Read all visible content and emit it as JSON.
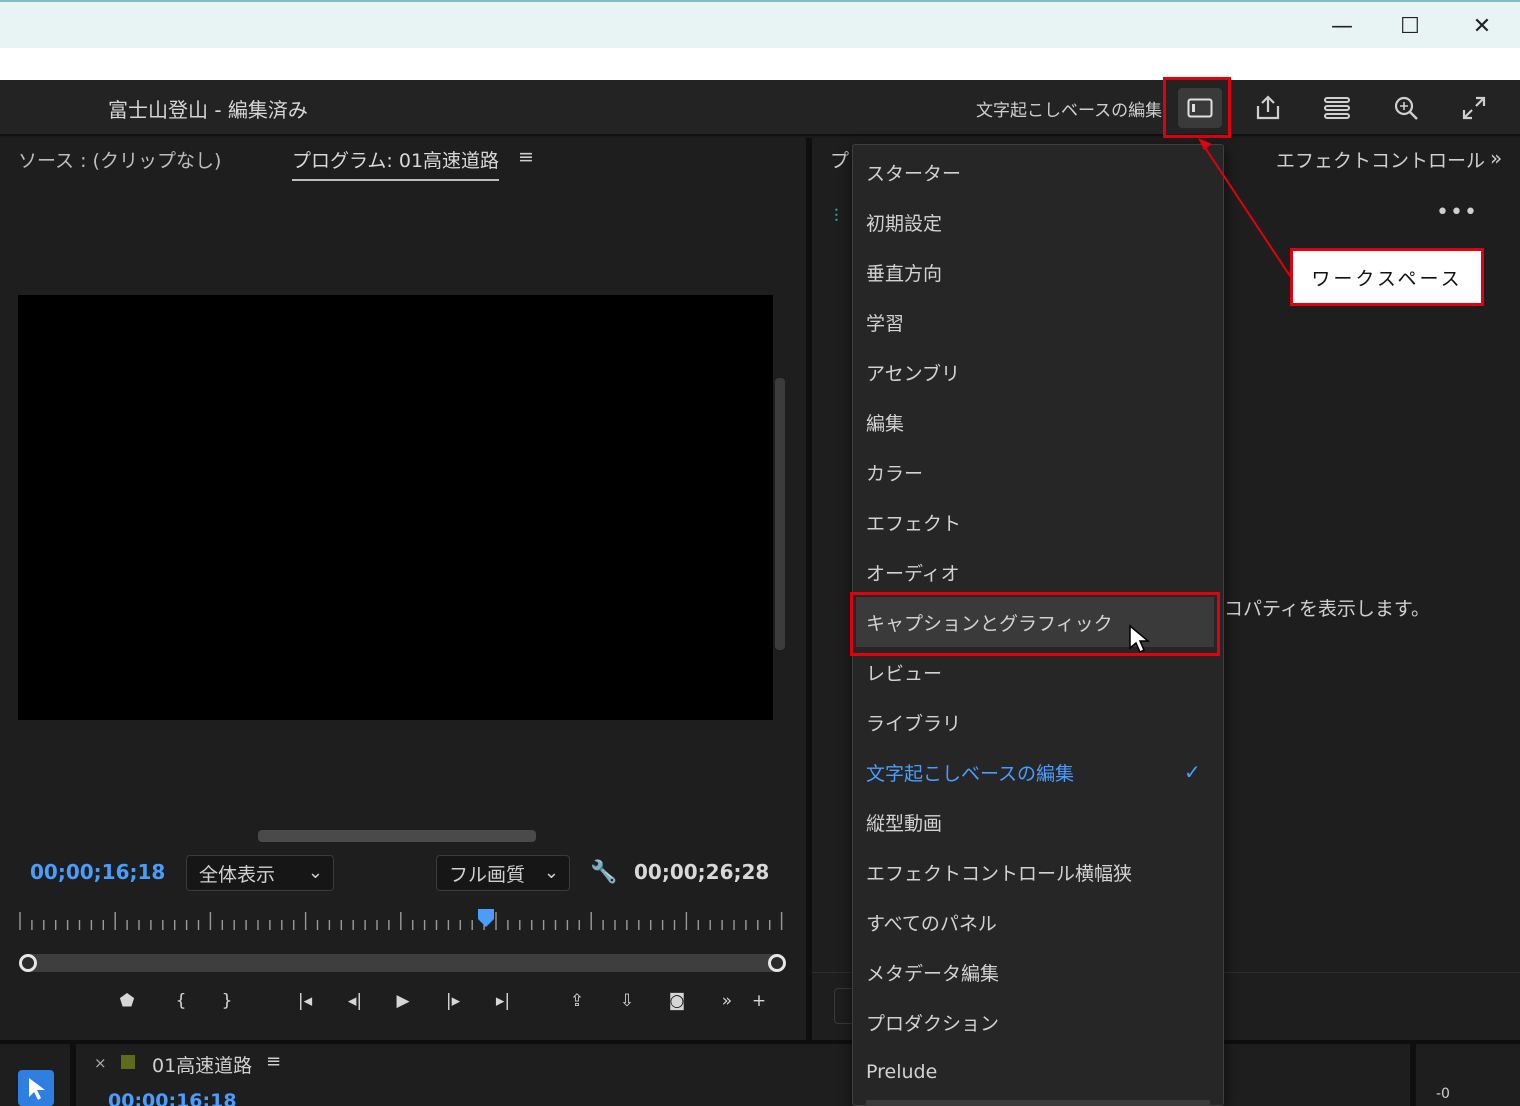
{
  "window": {
    "minimize_glyph": "—",
    "maximize_glyph": "☐",
    "close_glyph": "✕"
  },
  "header": {
    "project_title": "富士山登山 - 編集済み",
    "workspace_label": "文字起こしベースの編集",
    "icons": [
      "workspace-icon",
      "export-icon",
      "quick-export-icon",
      "search-icon",
      "fullscreen-icon"
    ]
  },
  "left_panel": {
    "tab_source": "ソース : (クリップなし)",
    "tab_program": "プログラム: 01高速道路",
    "tab_menu": "≡",
    "timecode_current": "00;00;16;18",
    "zoom_select": "全体表示",
    "quality_select": "フル画質",
    "timecode_duration": "00;00;26;28",
    "playhead_fraction": 0.61,
    "transport_glyphs": [
      "⬟",
      "{",
      "}",
      "|◂",
      "◂|",
      "▶",
      "|▸",
      "▸|",
      "⇪",
      "⇩",
      "◙",
      "»",
      "+"
    ]
  },
  "right_panel": {
    "tab_p": "プ",
    "tab_effect_controls": "エフェクトコントロール",
    "more_glyph": "»",
    "dots": "•••",
    "message_fragment": "コパティを表示します。"
  },
  "menu": {
    "items": [
      "スターター",
      "初期設定",
      "垂直方向",
      "学習",
      "アセンブリ",
      "編集",
      "カラー",
      "エフェクト",
      "オーディオ",
      "キャプションとグラフィック",
      "レビュー",
      "ライブラリ",
      "文字起こしベースの編集",
      "縦型動画",
      "エフェクトコントロール横幅狭",
      "すべてのパネル",
      "メタデータ編集",
      "プロダクション",
      "Prelude"
    ],
    "hover_index": 9,
    "active_index": 12,
    "check_glyph": "✓"
  },
  "callout": {
    "text": "ワークスペース"
  },
  "timeline": {
    "close_glyph": "×",
    "sequence_name": "01高速道路",
    "menu_glyph": "≡",
    "timecode": "00;00;16;18",
    "right_fragment": "-0"
  },
  "colors": {
    "accent_blue": "#4a9dff",
    "annotation_red": "#e0000f",
    "panel_bg": "#1e1e1e",
    "menu_bg": "#262626"
  }
}
